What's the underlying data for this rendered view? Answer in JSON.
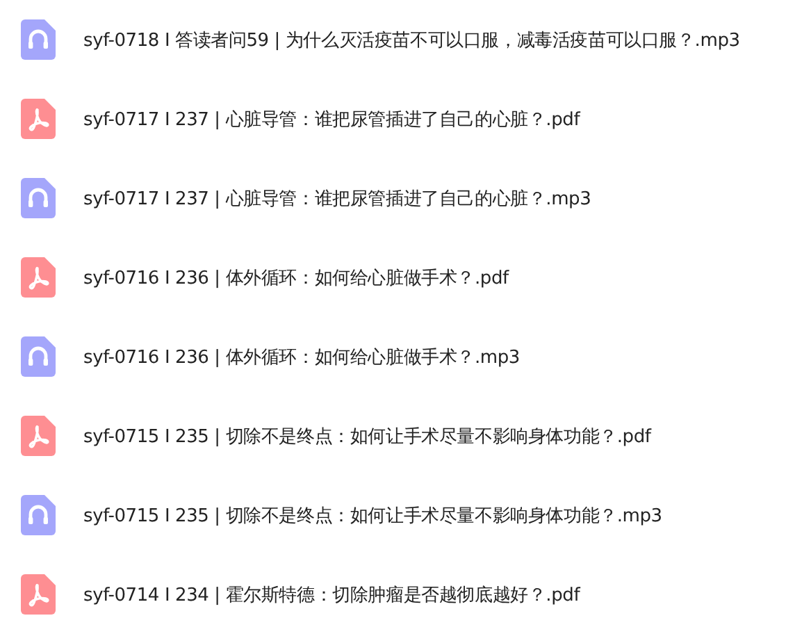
{
  "files": [
    {
      "kind": "audio",
      "name": "syf-0718 I 答读者问59 | 为什么灭活疫苗不可以口服，减毒活疫苗可以口服？.mp3"
    },
    {
      "kind": "pdf",
      "name": "syf-0717 I 237 | 心脏导管：谁把尿管插进了自己的心脏？.pdf"
    },
    {
      "kind": "audio",
      "name": "syf-0717 I 237 | 心脏导管：谁把尿管插进了自己的心脏？.mp3"
    },
    {
      "kind": "pdf",
      "name": "syf-0716 I 236 | 体外循环：如何给心脏做手术？.pdf"
    },
    {
      "kind": "audio",
      "name": "syf-0716 I 236 | 体外循环：如何给心脏做手术？.mp3"
    },
    {
      "kind": "pdf",
      "name": "syf-0715 I 235 | 切除不是终点：如何让手术尽量不影响身体功能？.pdf"
    },
    {
      "kind": "audio",
      "name": "syf-0715 I 235 | 切除不是终点：如何让手术尽量不影响身体功能？.mp3"
    },
    {
      "kind": "pdf",
      "name": "syf-0714 I 234 | 霍尔斯特德：切除肿瘤是否越彻底越好？.pdf"
    }
  ]
}
